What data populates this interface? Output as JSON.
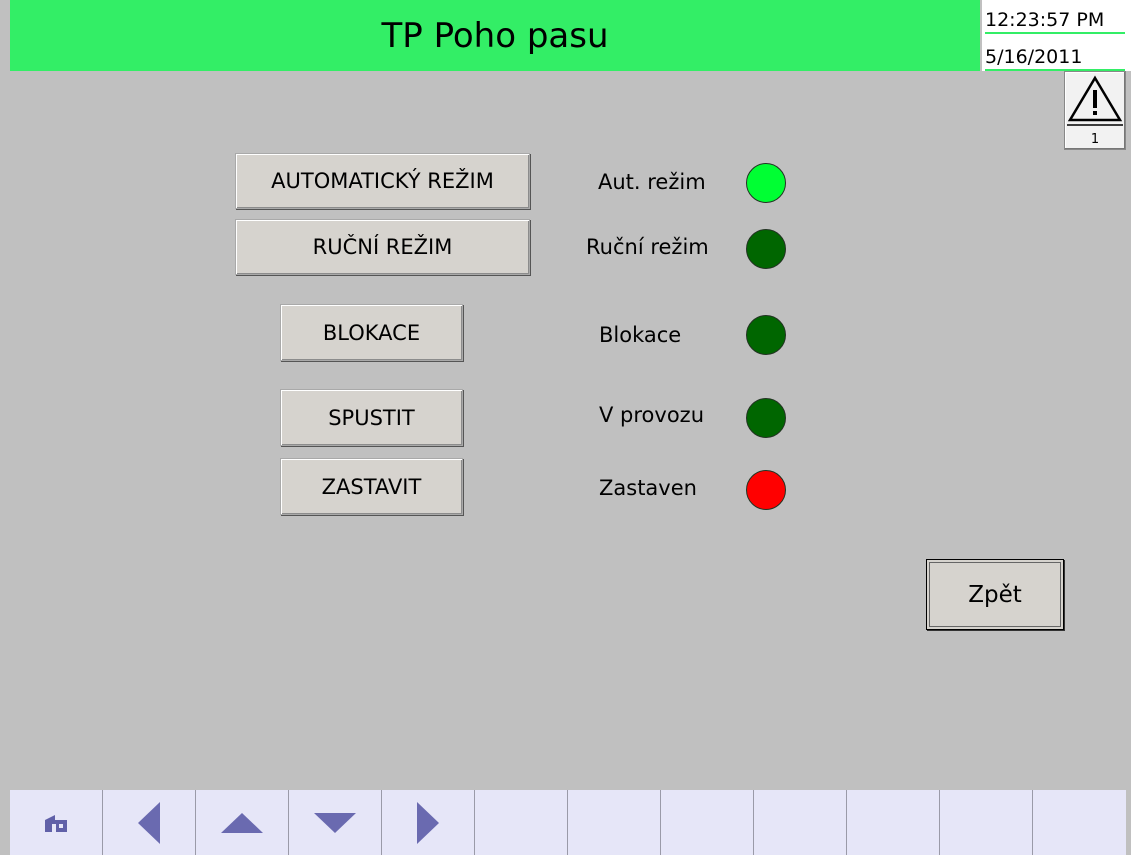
{
  "header": {
    "title": "TP Poho pasu",
    "time": "12:23:57 PM",
    "date": "5/16/2011",
    "color": "#33ee66"
  },
  "alarm": {
    "icon": "warning-icon",
    "count": "1"
  },
  "controls": [
    {
      "key": "auto",
      "button": "AUTOMATICKÝ REŽIM",
      "status": "Aut. režim",
      "lamp": "#00ff33"
    },
    {
      "key": "manual",
      "button": "RUČNÍ REŽIM",
      "status": "Ruční režim",
      "lamp": "#006600"
    },
    {
      "key": "block",
      "button": "BLOKACE",
      "status": "Blokace",
      "lamp": "#006600"
    },
    {
      "key": "start",
      "button": "SPUSTIT",
      "status": "V provozu",
      "lamp": "#006600"
    },
    {
      "key": "stop",
      "button": "ZASTAVIT",
      "status": "Zastaven",
      "lamp": "#ff0000"
    }
  ],
  "back_button": "Zpět",
  "nav": [
    {
      "icon": "home-icon"
    },
    {
      "icon": "arrow-left-icon"
    },
    {
      "icon": "arrow-up-icon"
    },
    {
      "icon": "arrow-down-icon"
    },
    {
      "icon": "arrow-right-icon"
    },
    {
      "icon": ""
    },
    {
      "icon": ""
    },
    {
      "icon": ""
    },
    {
      "icon": ""
    },
    {
      "icon": ""
    },
    {
      "icon": ""
    },
    {
      "icon": ""
    }
  ]
}
